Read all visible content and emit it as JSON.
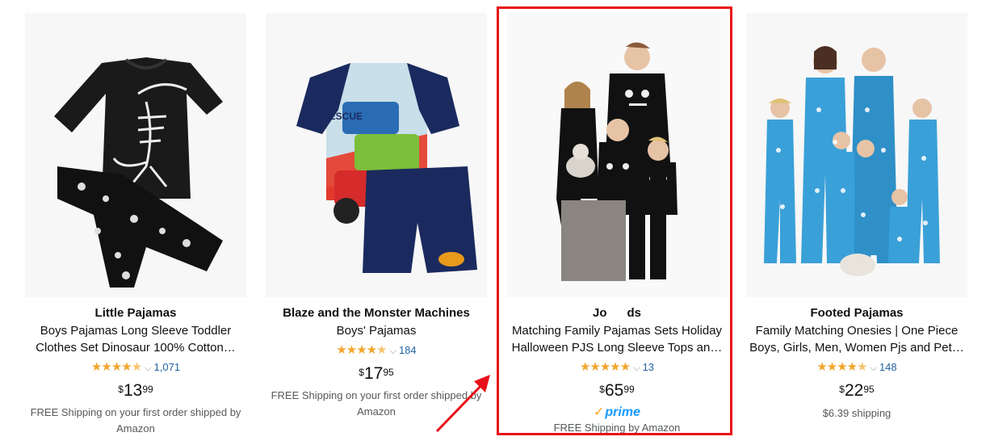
{
  "products": [
    {
      "brand": "Little Pajamas",
      "title_line1": "Boys Pajamas Long Sleeve Toddler",
      "title_line2": "Clothes Set Dinosaur 100% Cotton…",
      "rating_count": "1,071",
      "price_currency": "$",
      "price_whole": "13",
      "price_fraction": "99",
      "shipping_line1": "FREE Shipping on your first order shipped by",
      "shipping_line2": "Amazon"
    },
    {
      "brand": "Blaze and the Monster Machines",
      "title_line1": "Boys' Pajamas",
      "rating_count": "184",
      "price_currency": "$",
      "price_whole": "17",
      "price_fraction": "95",
      "shipping_line1": "FREE Shipping on your first order shipped by",
      "shipping_line2": "Amazon",
      "image_text": "RESCUE"
    },
    {
      "brand": "Jo      ds",
      "title_line1": "Matching Family Pajamas Sets Holiday",
      "title_line2": "Halloween PJS Long Sleeve Tops an…",
      "rating_count": "13",
      "price_currency": "$",
      "price_whole": "65",
      "price_fraction": "99",
      "prime_label": "prime",
      "shipping_line1": "FREE Shipping by Amazon"
    },
    {
      "brand": "Footed Pajamas",
      "title_line1": "Family Matching Onesies | One Piece",
      "title_line2": "Boys, Girls, Men, Women Pjs and Pet…",
      "rating_count": "148",
      "price_currency": "$",
      "price_whole": "22",
      "price_fraction": "95",
      "shipping_line1": "$6.39 shipping"
    }
  ],
  "colors": {
    "star": "#f2a52b",
    "link": "#2162a1",
    "prime": "#1399ff",
    "highlight": "#e8101a"
  }
}
